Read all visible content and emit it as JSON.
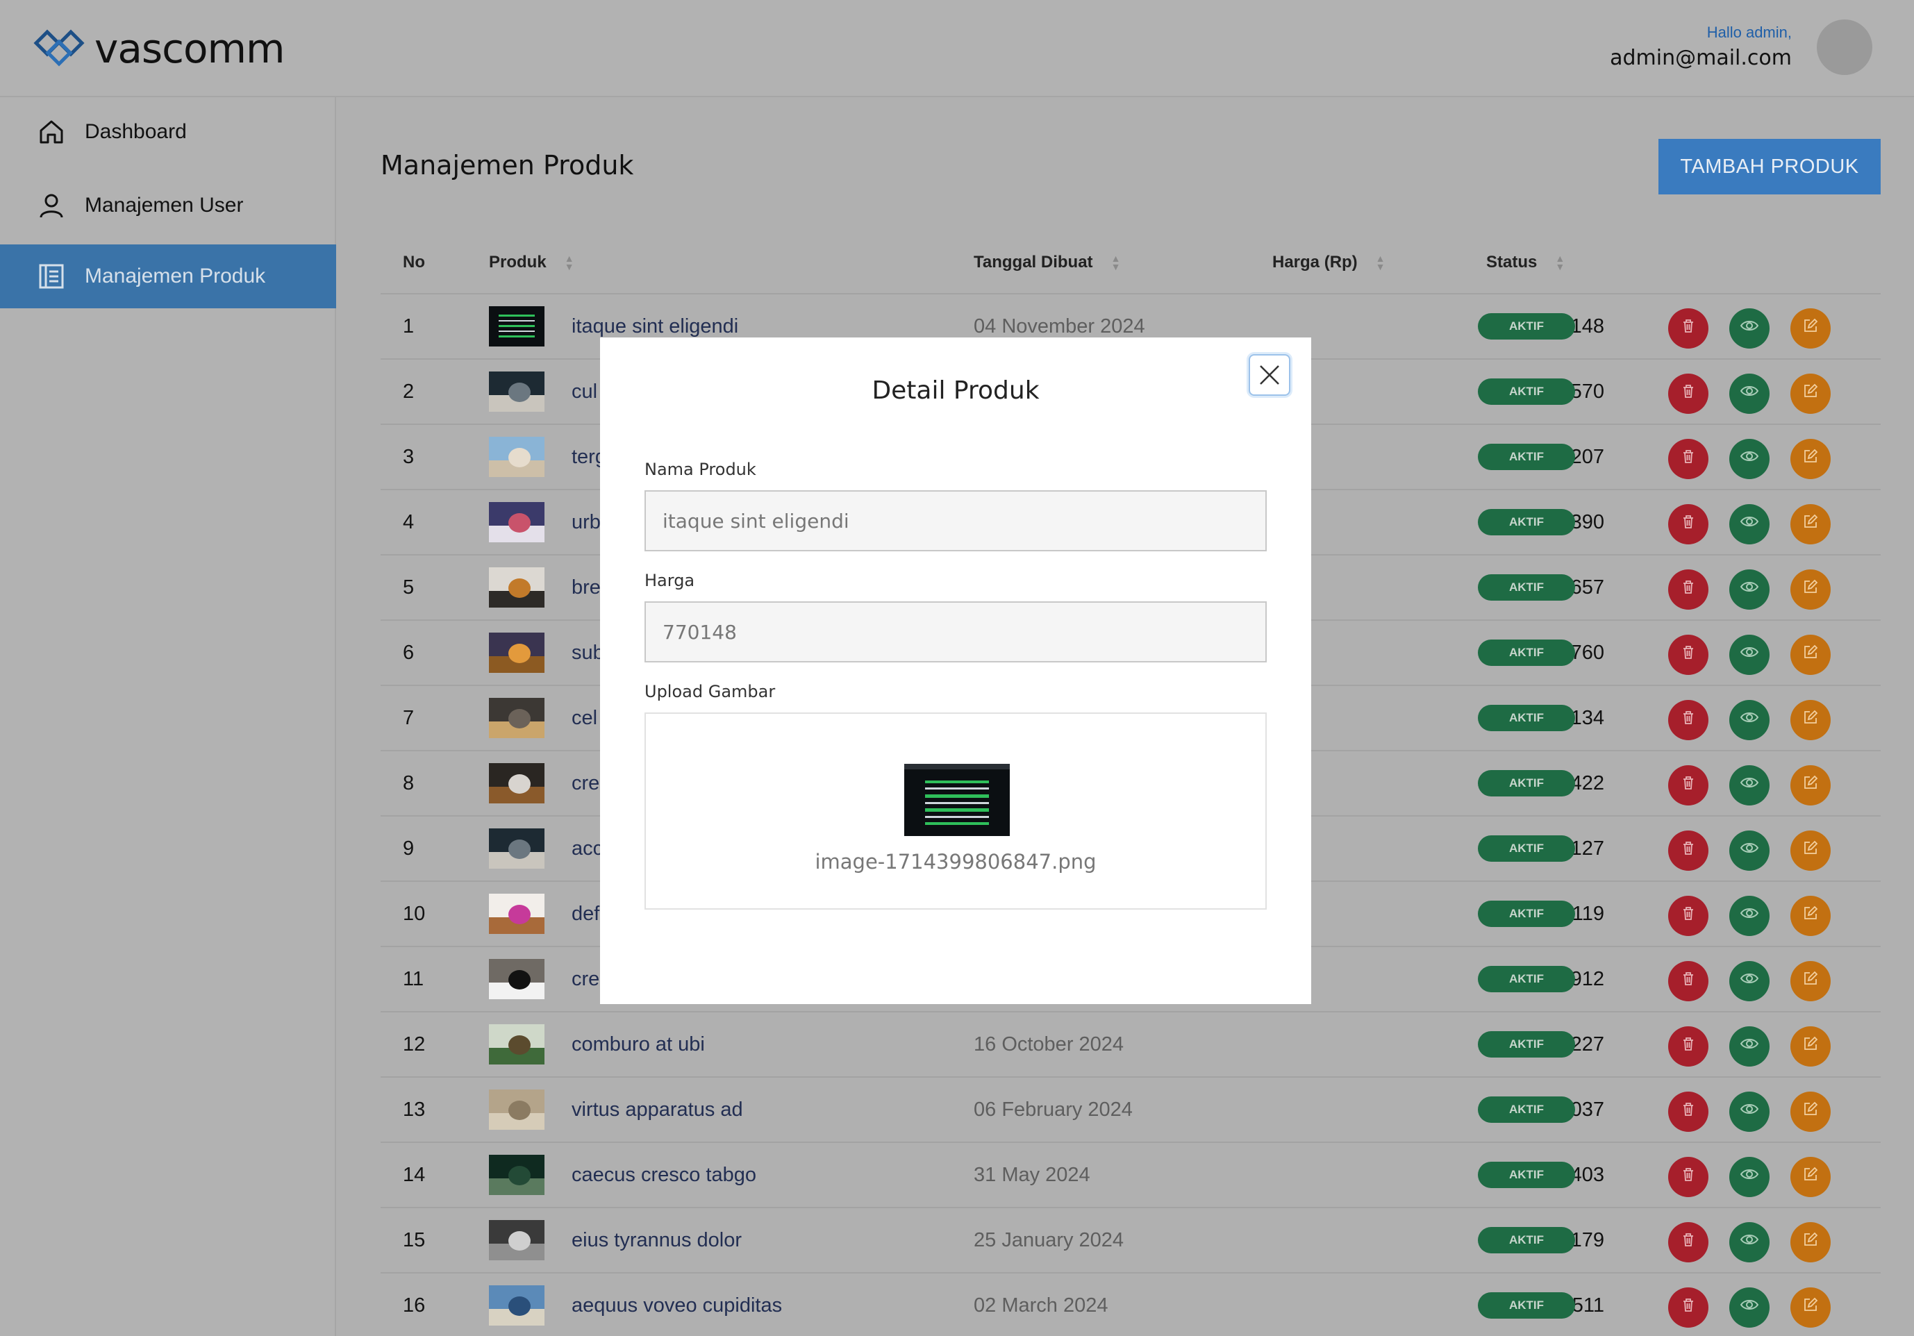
{
  "header": {
    "logo_text": "vascomm",
    "greeting": "Hallo admin,",
    "email": "admin@mail.com"
  },
  "sidebar": {
    "items": [
      {
        "label": "Dashboard",
        "icon": "home-icon",
        "active": false
      },
      {
        "label": "Manajemen User",
        "icon": "user-icon",
        "active": false
      },
      {
        "label": "Manajemen Produk",
        "icon": "document-list-icon",
        "active": true
      }
    ]
  },
  "main": {
    "title": "Manajemen Produk",
    "add_button": "TAMBAH PRODUK"
  },
  "table": {
    "headers": {
      "no": "No",
      "produk": "Produk",
      "tanggal": "Tanggal Dibuat",
      "harga": "Harga (Rp)",
      "status": "Status"
    },
    "rows": [
      {
        "no": "1",
        "name": "itaque sint eligendi",
        "date": "04 November 2024",
        "price": "Rp 770.148",
        "status": "AKTIF",
        "thumb": "screen"
      },
      {
        "no": "2",
        "name": "cul",
        "date": "",
        "price": "Rp 345.570",
        "status": "AKTIF",
        "thumb": "cat-dark"
      },
      {
        "no": "3",
        "name": "terg",
        "date": "",
        "price": "Rp 722.207",
        "status": "AKTIF",
        "thumb": "beach"
      },
      {
        "no": "4",
        "name": "urb",
        "date": "",
        "price": "Rp 45.390",
        "status": "AKTIF",
        "thumb": "flowers"
      },
      {
        "no": "5",
        "name": "bre",
        "date": "",
        "price": "Rp 310.657",
        "status": "AKTIF",
        "thumb": "cat-calico"
      },
      {
        "no": "6",
        "name": "sub",
        "date": "",
        "price": "Rp 18.760",
        "status": "AKTIF",
        "thumb": "sunset"
      },
      {
        "no": "7",
        "name": "cel",
        "date": "",
        "price": "Rp 21.134",
        "status": "AKTIF",
        "thumb": "desk"
      },
      {
        "no": "8",
        "name": "cre",
        "date": "",
        "price": "Rp 148.422",
        "status": "AKTIF",
        "thumb": "laptop"
      },
      {
        "no": "9",
        "name": "acc",
        "date": "",
        "price": "Rp 192.127",
        "status": "AKTIF",
        "thumb": "cat-dark"
      },
      {
        "no": "10",
        "name": "def",
        "date": "",
        "price": "Rp 370.119",
        "status": "AKTIF",
        "thumb": "pink-flower"
      },
      {
        "no": "11",
        "name": "cre",
        "date": "",
        "price": "Rp 482.912",
        "status": "AKTIF",
        "thumb": "cat-bw"
      },
      {
        "no": "12",
        "name": "comburo at ubi",
        "date": "16 October 2024",
        "price": "Rp 150.227",
        "status": "AKTIF",
        "thumb": "forest"
      },
      {
        "no": "13",
        "name": "virtus apparatus ad",
        "date": "06 February 2024",
        "price": "Rp 564.037",
        "status": "AKTIF",
        "thumb": "deer"
      },
      {
        "no": "14",
        "name": "caecus cresco tabgo",
        "date": "31 May 2024",
        "price": "Rp 523.403",
        "status": "AKTIF",
        "thumb": "dark-forest"
      },
      {
        "no": "15",
        "name": "eius tyrannus dolor",
        "date": "25 January 2024",
        "price": "Rp 883.179",
        "status": "AKTIF",
        "thumb": "cat-grey"
      },
      {
        "no": "16",
        "name": "aequus voveo cupiditas",
        "date": "02 March 2024",
        "price": "Rp 616.511",
        "status": "AKTIF",
        "thumb": "ocean"
      }
    ]
  },
  "modal": {
    "title": "Detail Produk",
    "name_label": "Nama Produk",
    "name_value": "itaque sint eligendi",
    "price_label": "Harga",
    "price_value": "770148",
    "upload_label": "Upload Gambar",
    "file_name": "image-1714399806847.png"
  },
  "colors": {
    "sidebar_active": "#3a73a8",
    "add_button": "#3a7bbf",
    "status_badge": "#1e6b44",
    "delete_button": "#a61f2b",
    "view_button": "#1e6b44",
    "edit_button": "#c27011"
  }
}
